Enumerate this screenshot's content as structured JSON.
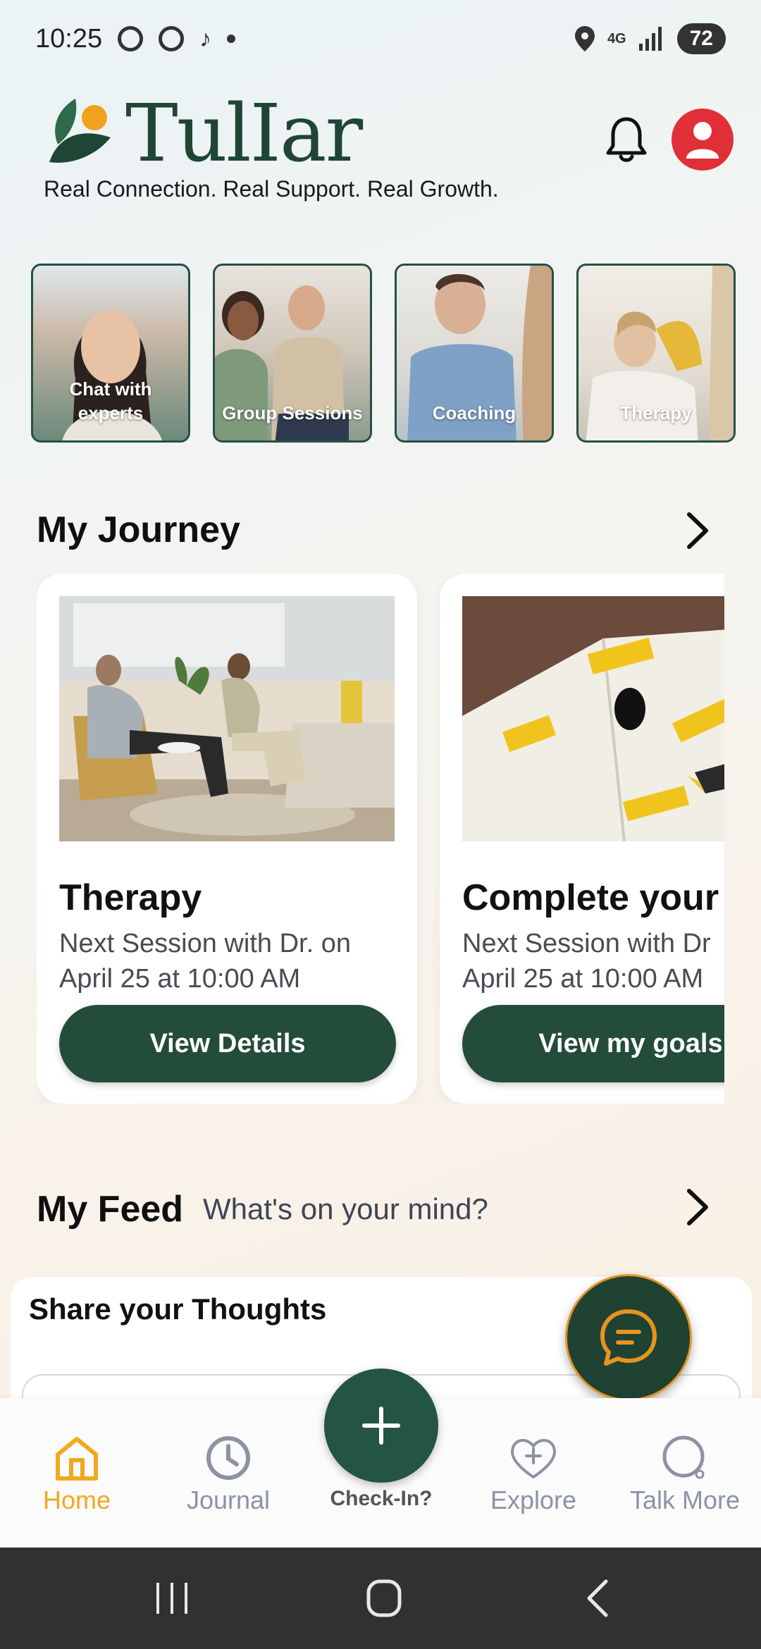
{
  "status_bar": {
    "time": "10:25",
    "network": "4G",
    "battery": "72"
  },
  "header": {
    "logo_text": "TulIar",
    "tagline": "Real Connection. Real Support. Real Growth.",
    "brand_color": "#1f4535"
  },
  "categories": [
    {
      "label": "Chat with experts"
    },
    {
      "label": "Group Sessions"
    },
    {
      "label": "Coaching"
    },
    {
      "label": "Therapy"
    }
  ],
  "journey": {
    "title": "My Journey",
    "cards": [
      {
        "title": "Therapy",
        "subtitle_line1": "Next Session with Dr. on",
        "subtitle_line2": "April 25 at 10:00 AM",
        "button": "View Details"
      },
      {
        "title": "Complete your",
        "subtitle_line1": "Next Session with Dr",
        "subtitle_line2": "April 25 at 10:00 AM",
        "button": "View my goals"
      }
    ]
  },
  "feed": {
    "title": "My Feed",
    "prompt": "What's on your mind?",
    "share_title": "Share your Thoughts"
  },
  "bottom_nav": {
    "items": [
      {
        "label": "Home",
        "icon": "home-icon",
        "active": true
      },
      {
        "label": "Journal",
        "icon": "clock-icon",
        "active": false
      },
      {
        "label": "Check-In?",
        "icon": "plus-icon",
        "active": false
      },
      {
        "label": "Explore",
        "icon": "heart-plus-icon",
        "active": false
      },
      {
        "label": "Talk More",
        "icon": "chat-bubble-icon",
        "active": false
      }
    ],
    "active_color": "#f2a81d",
    "inactive_color": "#8b93a3"
  },
  "colors": {
    "primary_green": "#244c3b",
    "accent_orange": "#e6941f",
    "avatar_red": "#e02f36"
  }
}
